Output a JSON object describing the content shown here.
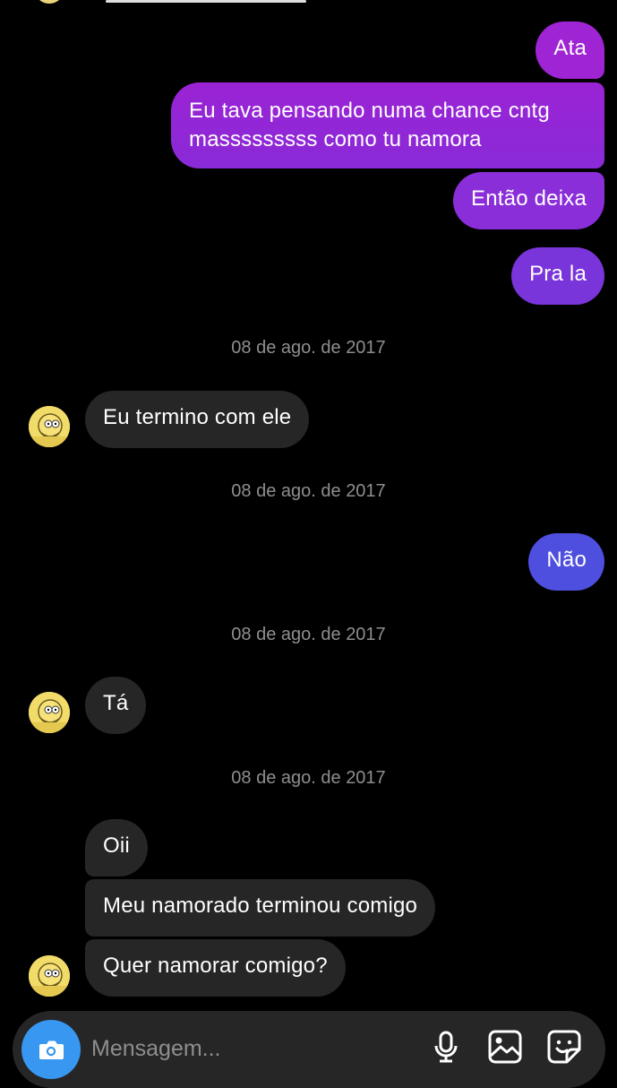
{
  "messages": {
    "out_ata": "Ata",
    "out_pensando_line1": "Eu tava pensando numa chance cntg",
    "out_pensando_line2": "masssssssss como tu namora",
    "out_entao": "Então deixa",
    "out_prala": "Pra la",
    "in_termino": "Eu termino com ele",
    "out_nao": "Não",
    "in_ta": "Tá",
    "in_oii": "Oii",
    "in_namorado": "Meu namorado terminou comigo",
    "in_quer": "Quer namorar comigo?"
  },
  "timestamps": [
    "08 de ago. de 2017",
    "08 de ago. de 2017",
    "08 de ago. de 2017",
    "08 de ago. de 2017"
  ],
  "composer": {
    "placeholder": "Mensagem..."
  },
  "icons": [
    "camera-icon",
    "microphone-icon",
    "gallery-icon",
    "sticker-icon"
  ],
  "colors": {
    "bubble_out_top": "#a425d6",
    "bubble_out_mid": "#7b2fd9",
    "bubble_out_bottom": "#4f4fe0",
    "bubble_in": "#262626",
    "camera_button": "#3897f0",
    "timestamp": "#8e8e8e"
  }
}
